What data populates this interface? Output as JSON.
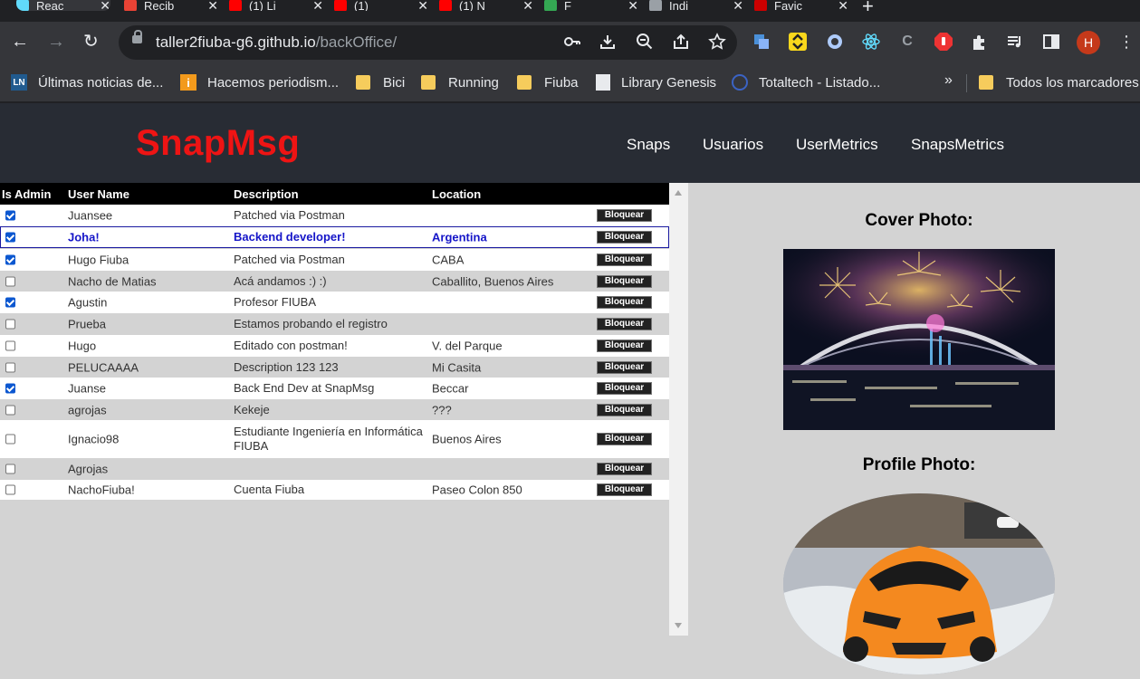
{
  "browser": {
    "tabs": [
      {
        "title": "Reac",
        "color": "#61dafb"
      },
      {
        "title": "Recib",
        "color": "#ea4335"
      },
      {
        "title": "(1) Li",
        "color": "#ff0000"
      },
      {
        "title": "(1)",
        "color": "#ff0000"
      },
      {
        "title": "(1) N",
        "color": "#ff0000"
      },
      {
        "title": "F",
        "color": "#34a853"
      },
      {
        "title": "Indi",
        "color": "#9aa0a6"
      },
      {
        "title": "Favic",
        "color": "#cc0000"
      }
    ],
    "close_glyph": "✕",
    "new_tab_glyph": "+",
    "url_host": "taller2fiuba-g6.github.io",
    "url_path": "/backOffice/",
    "profile_initial": "H",
    "bookmarks": [
      {
        "label": "Últimas noticias de...",
        "icon": "ln-logo-icon"
      },
      {
        "label": "Hacemos periodism...",
        "icon": "info-logo-icon"
      },
      {
        "label": "Bici",
        "icon": "folder-icon"
      },
      {
        "label": "Running",
        "icon": "folder-icon"
      },
      {
        "label": "Fiuba",
        "icon": "folder-icon"
      },
      {
        "label": "Library Genesis",
        "icon": "library-icon"
      },
      {
        "label": "Totaltech - Listado...",
        "icon": "totaltech-icon"
      }
    ],
    "more_bookmarks": "»",
    "all_bookmarks": "Todos los marcadores"
  },
  "app": {
    "logo": "SnapMsg",
    "nav": [
      "Snaps",
      "Usuarios",
      "UserMetrics",
      "SnapsMetrics"
    ]
  },
  "table": {
    "headers": [
      "Is Admin",
      "User Name",
      "Description",
      "Location"
    ],
    "block_label": "Bloquear",
    "rows": [
      {
        "admin": true,
        "name": "Juansee",
        "description": "Patched via Postman",
        "location": ""
      },
      {
        "admin": true,
        "name": "Joha!",
        "description": "Backend developer!",
        "location": "Argentina"
      },
      {
        "admin": true,
        "name": "Hugo Fiuba",
        "description": "Patched via Postman",
        "location": "CABA"
      },
      {
        "admin": false,
        "name": "Nacho de Matias",
        "description": "Acá andamos :) :)",
        "location": "Caballito, Buenos Aires"
      },
      {
        "admin": true,
        "name": "Agustin",
        "description": "Profesor FIUBA",
        "location": ""
      },
      {
        "admin": false,
        "name": "Prueba",
        "description": "Estamos probando el registro",
        "location": ""
      },
      {
        "admin": false,
        "name": "Hugo",
        "description": "Editado con postman!",
        "location": "V. del Parque"
      },
      {
        "admin": false,
        "name": "PELUCAAAA",
        "description": "Description 123 123",
        "location": "Mi Casita"
      },
      {
        "admin": true,
        "name": "Juanse",
        "description": "Back End Dev at SnapMsg",
        "location": "Beccar"
      },
      {
        "admin": false,
        "name": "agrojas",
        "description": "Kekeje",
        "location": "???"
      },
      {
        "admin": false,
        "name": "Ignacio98",
        "description": "Estudiante Ingeniería en Informática FIUBA",
        "location": "Buenos Aires"
      },
      {
        "admin": false,
        "name": "Agrojas",
        "description": "",
        "location": ""
      },
      {
        "admin": false,
        "name": "NachoFiuba!",
        "description": "Cuenta Fiuba",
        "location": "Paseo Colon 850"
      }
    ],
    "selected_index": 1
  },
  "details": {
    "cover_title": "Cover Photo:",
    "profile_title": "Profile Photo:"
  }
}
